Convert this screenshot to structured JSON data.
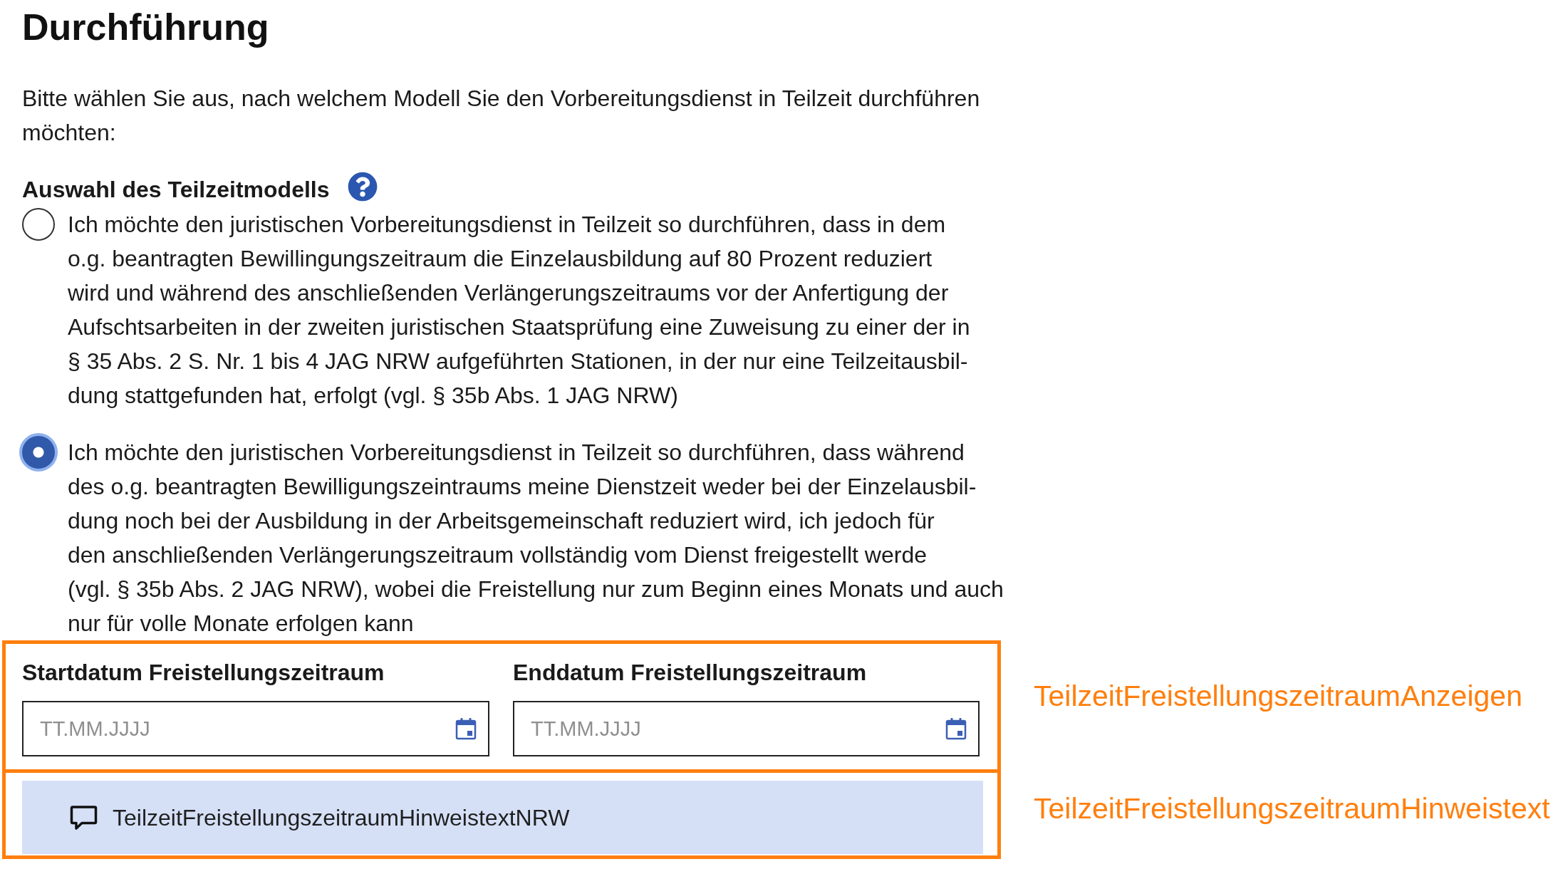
{
  "section": {
    "title": "Durchführung",
    "intro_lines": [
      "Bitte wählen Sie aus, nach welchem Modell Sie den Vorbereitungsdienst in Teilzeit durchführen",
      "möchten:"
    ]
  },
  "model_choice": {
    "label": "Auswahl des Teilzeitmodells",
    "options": [
      {
        "selected": false,
        "lines": [
          "Ich möchte den juristischen Vorbereitungsdienst in Teilzeit so durchführen, dass in dem",
          "o.g. beantragten Bewillingungszeitraum die Einzelausbildung auf 80 Prozent reduziert",
          "wird und während des anschließenden Verlängerungszeitraums vor der Anfertigung der",
          "Aufschtsarbeiten in der zweiten juristischen Staatsprüfung eine Zuweisung zu einer der in",
          "§ 35 Abs. 2 S. Nr. 1 bis 4 JAG NRW aufgeführten Stationen, in der nur eine Teilzeitausbil-",
          "dung stattgefunden hat, erfolgt (vgl. § 35b Abs. 1 JAG NRW)"
        ]
      },
      {
        "selected": true,
        "lines": [
          "Ich möchte den juristischen Vorbereitungsdienst in Teilzeit so durchführen, dass während",
          "des o.g. beantragten Bewilligungszeintraums meine Dienstzeit weder bei der Einzelausbil-",
          "dung noch bei der Ausbildung in der Arbeitsgemeinschaft reduziert wird, ich jedoch für",
          "den anschließenden Verlängerungszeitraum vollständig vom Dienst freigestellt werde",
          "(vgl. § 35b Abs. 2 JAG NRW), wobei die Freistellung nur zum Beginn eines Monats und auch",
          "nur für volle Monate erfolgen kann"
        ]
      }
    ]
  },
  "date_fields": {
    "fields": [
      {
        "label": "Startdatum Freistellungszeitraum",
        "placeholder": "TT.MM.JJJJ"
      },
      {
        "label": "Enddatum Freistellungszeitraum",
        "placeholder": "TT.MM.JJJJ"
      }
    ],
    "annotation": "TeilzeitFreistellungszeitraumAnzeigen"
  },
  "notice": {
    "text": "TeilzeitFreistellungszeitraumHinweistextNRW",
    "annotation": "TeilzeitFreistellungszeitraumHinweistext"
  }
}
